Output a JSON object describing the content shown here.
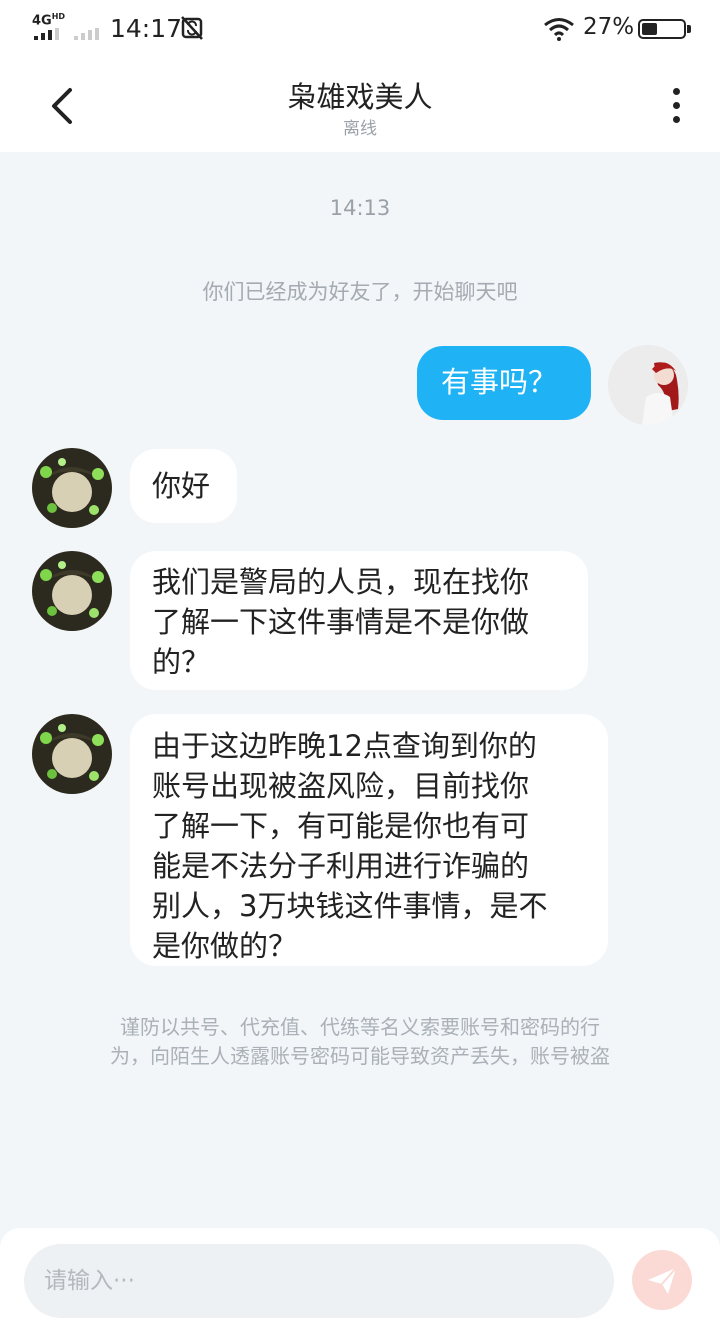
{
  "status_bar": {
    "network": "4G",
    "network_sup": "HD",
    "time": "14:17",
    "battery_percent": "27%",
    "battery_level": 0.27
  },
  "header": {
    "title": "枭雄戏美人",
    "status": "离线"
  },
  "chat": {
    "timestamp": "14:13",
    "system_note": "你们已经成为好友了，开始聊天吧",
    "messages": [
      {
        "direction": "out",
        "lines": [
          "有事吗？"
        ]
      },
      {
        "direction": "in",
        "lines": [
          "你好"
        ]
      },
      {
        "direction": "in",
        "lines": [
          "我们是警局的人员，现在找你",
          "了解一下这件事情是不是你做",
          "的？"
        ]
      },
      {
        "direction": "in",
        "lines": [
          "由于这边昨晚12点查询到你的",
          "账号出现被盗风险，目前找你",
          "了解一下，有可能是你也有可",
          "能是不法分子利用进行诈骗的",
          "别人，3万块钱这件事情，是不",
          "是你做的？"
        ]
      }
    ],
    "warning_lines": [
      "谨防以共号、代充值、代练等名义索要账号和密码的行",
      "为，向陌生人透露账号密码可能导致资产丢失，账号被盗"
    ]
  },
  "input": {
    "placeholder": "请输入···"
  },
  "colors": {
    "outgoing_bubble": "#1fb3f5",
    "incoming_bubble": "#ffffff",
    "chat_background": "#f2f6f8",
    "send_button": "#fbdad5"
  },
  "icons": {
    "back": "chevron-left-icon",
    "more": "more-vertical-icon",
    "send": "paper-plane-icon",
    "wifi": "wifi-icon",
    "sync": "sync-off-icon"
  }
}
